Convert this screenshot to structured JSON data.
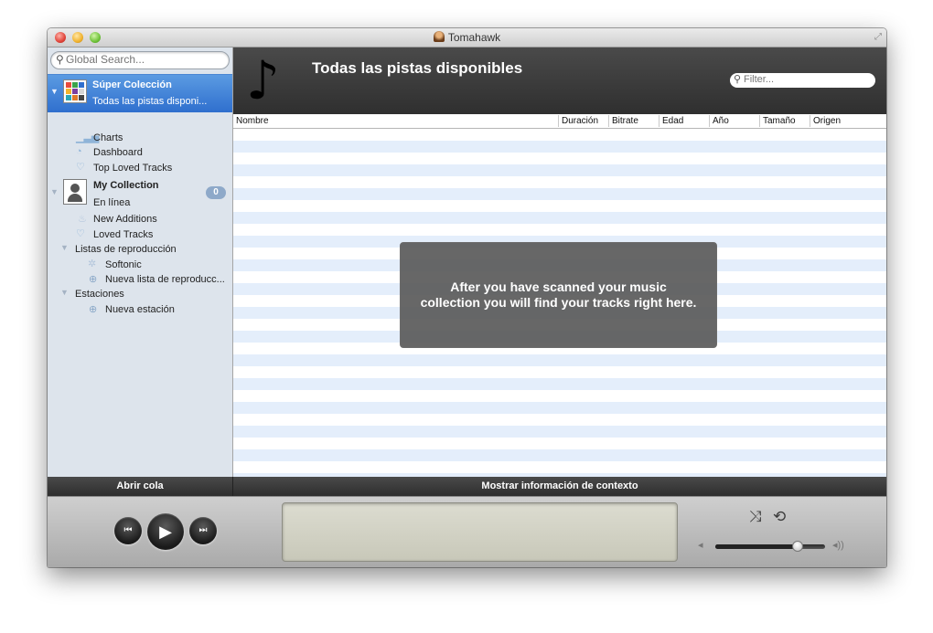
{
  "window": {
    "title": "Tomahawk"
  },
  "sidebar": {
    "search_placeholder": "Global Search...",
    "super_collection": {
      "title": "Súper Colección",
      "subtitle": "Todas las pistas disponi..."
    },
    "items_top": [
      {
        "label": "Charts",
        "icon": "charts-icon"
      },
      {
        "label": "Dashboard",
        "icon": "dashboard-icon"
      },
      {
        "label": "Top Loved Tracks",
        "icon": "heart-icon"
      }
    ],
    "my_collection": {
      "title": "My Collection",
      "status": "En línea",
      "badge": "0"
    },
    "items_mc": [
      {
        "label": "New Additions",
        "icon": "flame-icon"
      },
      {
        "label": "Loved Tracks",
        "icon": "heart-icon"
      }
    ],
    "playlists": {
      "header": "Listas de reproducción",
      "items": [
        "Softonic",
        "Nueva lista de reproducc..."
      ]
    },
    "stations": {
      "header": "Estaciones",
      "items": [
        "Nueva estación"
      ]
    },
    "bottom_label": "Abrir cola"
  },
  "main": {
    "title": "Todas las pistas disponibles",
    "filter_placeholder": "Filter...",
    "columns": [
      "Nombre",
      "Duración",
      "Bitrate",
      "Edad",
      "Año",
      "Tamaño",
      "Origen"
    ],
    "empty_message": "After you have scanned your music collection you will find your tracks right here.",
    "bottom_label": "Mostrar información de contexto"
  },
  "player": {
    "controls": [
      "previous-icon",
      "play-icon",
      "next-icon",
      "shuffle-icon",
      "repeat-icon"
    ],
    "volume": 0.75
  }
}
